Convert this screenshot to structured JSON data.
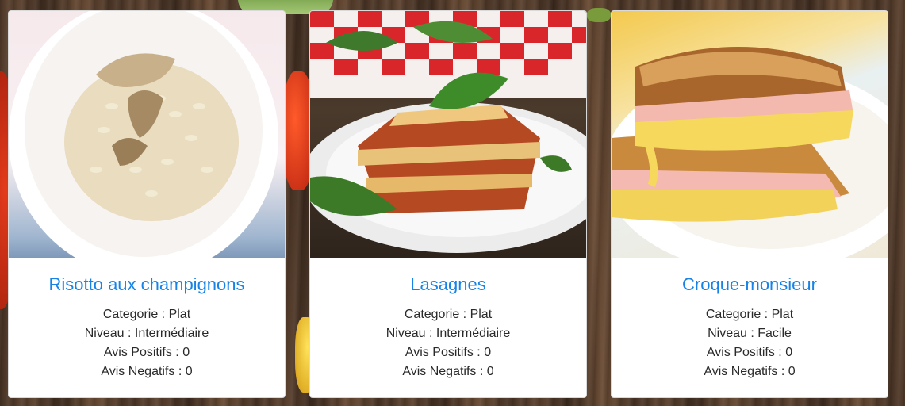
{
  "labels": {
    "category": "Categorie : ",
    "level": "Niveau : ",
    "positive": "Avis Positifs : ",
    "negative": "Avis Negatifs : "
  },
  "recipes": [
    {
      "title": "Risotto aux champignons",
      "category_line": "Categorie : Plat",
      "level_line": "Niveau : Intermédiaire",
      "positive_line": "Avis Positifs : 0",
      "negative_line": "Avis Negatifs : 0",
      "image": "risotto-photo"
    },
    {
      "title": "Lasagnes",
      "category_line": "Categorie : Plat",
      "level_line": "Niveau : Intermédiaire",
      "positive_line": "Avis Positifs : 0",
      "negative_line": "Avis Negatifs : 0",
      "image": "lasagna-photo"
    },
    {
      "title": "Croque-monsieur",
      "category_line": "Categorie : Plat",
      "level_line": "Niveau : Facile",
      "positive_line": "Avis Positifs : 0",
      "negative_line": "Avis Negatifs : 0",
      "image": "croque-monsieur-photo"
    }
  ]
}
